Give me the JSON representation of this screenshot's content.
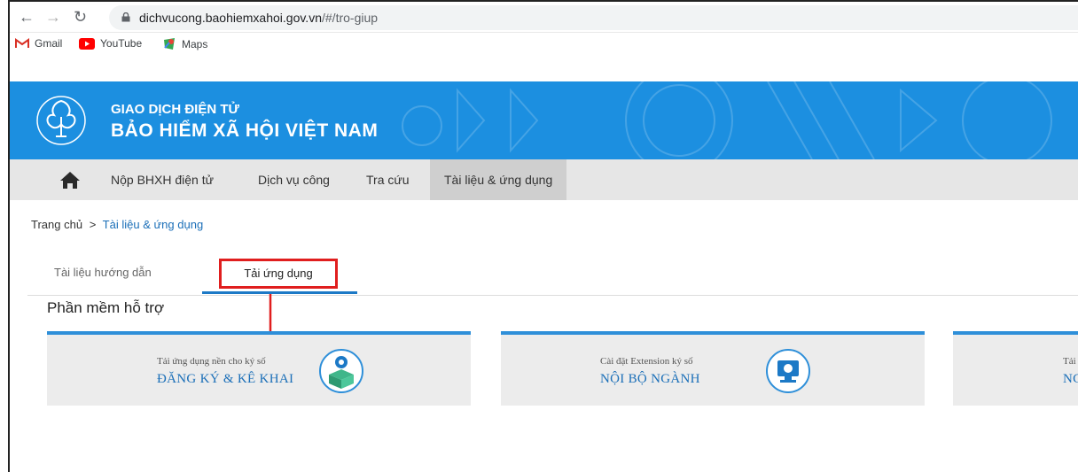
{
  "browser": {
    "url_domain": "dichvucong.baohiemxahoi.gov.vn",
    "url_path": "/#/tro-giup",
    "bookmarks": [
      "Gmail",
      "YouTube",
      "Maps"
    ]
  },
  "header": {
    "small_title": "GIAO DỊCH ĐIỆN TỬ",
    "big_title": "BẢO HIỂM XÃ HỘI VIỆT NAM"
  },
  "nav": {
    "items": [
      "Nộp BHXH điện tử",
      "Dịch vụ công",
      "Tra cứu",
      "Tài liệu & ứng dụng"
    ]
  },
  "breadcrumb": {
    "home": "Trang chủ",
    "sep": ">",
    "current": "Tài liệu & ứng dụng"
  },
  "tabs": {
    "inactive": "Tài liệu hướng dẫn",
    "active": "Tải ứng dụng"
  },
  "section_title": "Phần mềm hỗ trợ",
  "cards": [
    {
      "caption": "Tải ứng dụng nền cho ký số",
      "title": "ĐĂNG KÝ & KÊ KHAI"
    },
    {
      "caption": "Cài đặt Extension ký số",
      "title": "NỘI BỘ NGÀNH"
    },
    {
      "caption": "Tải",
      "title": "NC"
    }
  ],
  "colors": {
    "header_blue": "#1c8fe0",
    "accent_blue": "#2e8fd9",
    "highlight_red": "#e01e1e"
  }
}
